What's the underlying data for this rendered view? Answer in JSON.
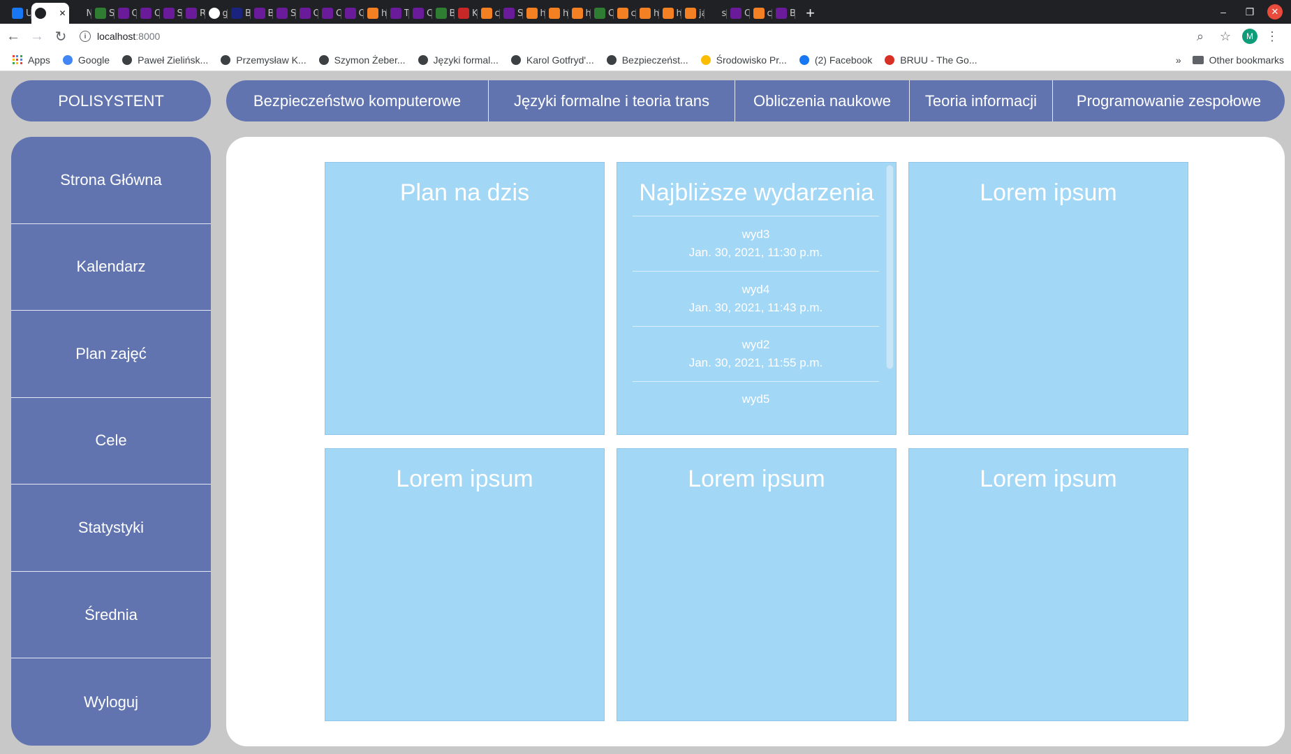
{
  "browser": {
    "tabs": [
      {
        "letter": "U",
        "color": "#1877f2",
        "icon": "facebook-icon"
      },
      {
        "letter": "",
        "color": "#ffffff",
        "icon": "globe-icon",
        "active": true
      },
      {
        "letter": "N",
        "color": "#202124",
        "icon": "sketch-icon"
      },
      {
        "letter": "S",
        "color": "#2e7d32",
        "icon": "w-icon"
      },
      {
        "letter": "C",
        "color": "#6a1b9a",
        "icon": "b-icon"
      },
      {
        "letter": "C",
        "color": "#6a1b9a",
        "icon": "b-icon"
      },
      {
        "letter": "S",
        "color": "#6a1b9a",
        "icon": "b-icon"
      },
      {
        "letter": "R",
        "color": "#6a1b9a",
        "icon": "b-icon"
      },
      {
        "letter": "g",
        "color": "#ffffff",
        "icon": "google-icon"
      },
      {
        "letter": "B",
        "color": "#1a237e",
        "icon": "a-icon"
      },
      {
        "letter": "B",
        "color": "#6a1b9a",
        "icon": "b-icon"
      },
      {
        "letter": "S",
        "color": "#6a1b9a",
        "icon": "b-icon"
      },
      {
        "letter": "C",
        "color": "#6a1b9a",
        "icon": "b-icon"
      },
      {
        "letter": "C",
        "color": "#6a1b9a",
        "icon": "b-icon"
      },
      {
        "letter": "C",
        "color": "#6a1b9a",
        "icon": "b-icon"
      },
      {
        "letter": "h",
        "color": "#f48024",
        "icon": "stackoverflow-icon"
      },
      {
        "letter": "T",
        "color": "#6a1b9a",
        "icon": "b-icon"
      },
      {
        "letter": "C",
        "color": "#6a1b9a",
        "icon": "b-icon"
      },
      {
        "letter": "B",
        "color": "#2e7d32",
        "icon": "w-icon"
      },
      {
        "letter": "K",
        "color": "#c62828",
        "icon": "game-icon"
      },
      {
        "letter": "c",
        "color": "#f48024",
        "icon": "stackoverflow-icon"
      },
      {
        "letter": "S",
        "color": "#6a1b9a",
        "icon": "b-icon"
      },
      {
        "letter": "h",
        "color": "#f48024",
        "icon": "stackoverflow-icon"
      },
      {
        "letter": "h",
        "color": "#f48024",
        "icon": "stackoverflow-icon"
      },
      {
        "letter": "h",
        "color": "#f48024",
        "icon": "stackoverflow-icon"
      },
      {
        "letter": "C",
        "color": "#2e7d32",
        "icon": "w-icon"
      },
      {
        "letter": "c",
        "color": "#f48024",
        "icon": "stackoverflow-icon"
      },
      {
        "letter": "h",
        "color": "#f48024",
        "icon": "stackoverflow-icon"
      },
      {
        "letter": "h",
        "color": "#f48024",
        "icon": "stackoverflow-icon"
      },
      {
        "letter": "ja",
        "color": "#f48024",
        "icon": "stackoverflow-icon"
      },
      {
        "letter": "s",
        "color": "#202124",
        "icon": "github-icon"
      },
      {
        "letter": "C",
        "color": "#6a1b9a",
        "icon": "b-icon"
      },
      {
        "letter": "c",
        "color": "#f48024",
        "icon": "stackoverflow-icon"
      },
      {
        "letter": "B",
        "color": "#6a1b9a",
        "icon": "b-icon"
      }
    ],
    "url_host": "localhost",
    "url_port": ":8000",
    "profile_letter": "M",
    "bookmarks": [
      {
        "label": "Apps",
        "icon": "apps-icon",
        "color": "#4285f4"
      },
      {
        "label": "Google",
        "icon": "google-icon",
        "color": "#4285f4"
      },
      {
        "label": "Paweł Zielińsk...",
        "icon": "globe-icon",
        "color": "#3c4043"
      },
      {
        "label": "Przemysław K...",
        "icon": "globe-icon",
        "color": "#3c4043"
      },
      {
        "label": "Szymon Żeber...",
        "icon": "globe-icon",
        "color": "#3c4043"
      },
      {
        "label": "Języki formal...",
        "icon": "globe-icon",
        "color": "#3c4043"
      },
      {
        "label": "Karol Gotfryd'...",
        "icon": "globe-icon",
        "color": "#3c4043"
      },
      {
        "label": "Bezpieczeńst...",
        "icon": "globe-icon",
        "color": "#3c4043"
      },
      {
        "label": "Środowisko Pr...",
        "icon": "google-drive-icon",
        "color": "#fbbc04"
      },
      {
        "label": "(2) Facebook",
        "icon": "facebook-icon",
        "color": "#1877f2"
      },
      {
        "label": "BRUU - The Go...",
        "icon": "magnet-icon",
        "color": "#d93025"
      }
    ],
    "other_bookmarks": "Other bookmarks",
    "overflow": "»"
  },
  "app": {
    "brand": "POLISYSTENT",
    "top_nav": [
      "Bezpieczeństwo komputerowe",
      "Języki formalne i teoria trans",
      "Obliczenia naukowe",
      "Teoria informacji",
      "Programowanie zespołowe"
    ],
    "side_nav": [
      "Strona Główna",
      "Kalendarz",
      "Plan zajęć",
      "Cele",
      "Statystyki",
      "Średnia",
      "Wyloguj"
    ],
    "cards": {
      "plan_title": "Plan na dzis",
      "events_title": "Najbliższe wydarzenia",
      "events": [
        {
          "name": "wyd3",
          "date": "Jan. 30, 2021, 11:30 p.m."
        },
        {
          "name": "wyd4",
          "date": "Jan. 30, 2021, 11:43 p.m."
        },
        {
          "name": "wyd2",
          "date": "Jan. 30, 2021, 11:55 p.m."
        },
        {
          "name": "wyd5",
          "date": ""
        }
      ],
      "lorem_1": "Lorem ipsum",
      "lorem_2": "Lorem ipsum",
      "lorem_3": "Lorem ipsum",
      "lorem_4": "Lorem ipsum"
    }
  }
}
